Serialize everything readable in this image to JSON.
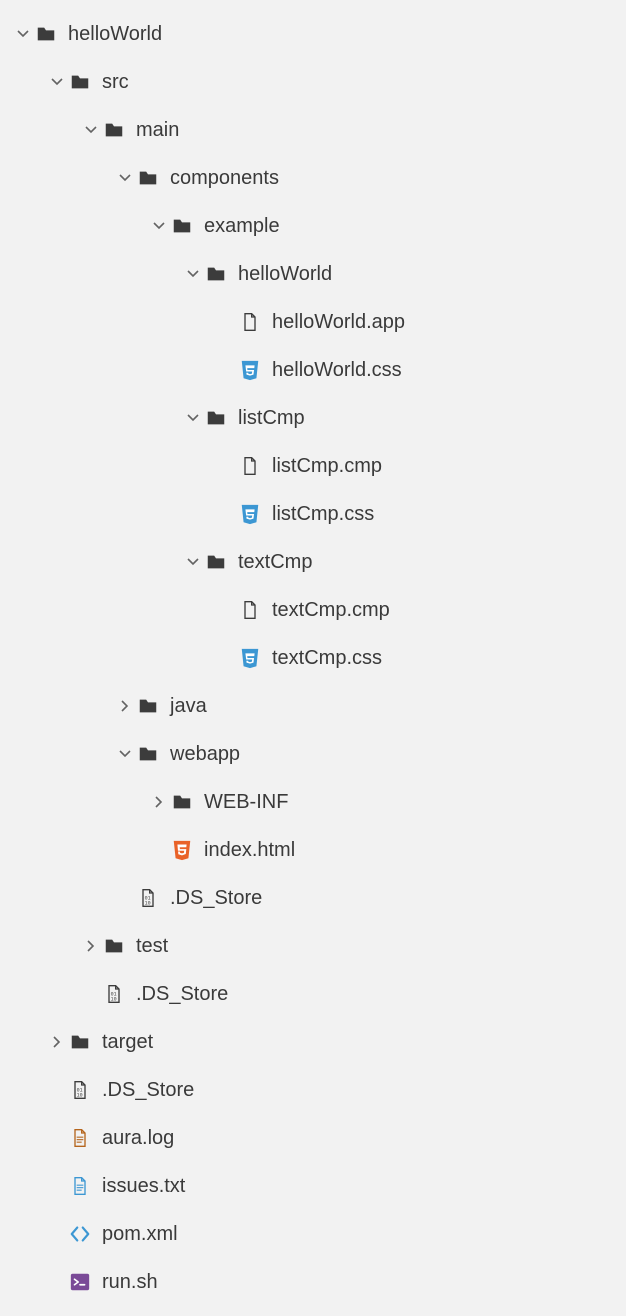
{
  "rows": [
    {
      "label": "helloWorld",
      "depth": 0,
      "expanded": true,
      "type": "folder"
    },
    {
      "label": "src",
      "depth": 1,
      "expanded": true,
      "type": "folder"
    },
    {
      "label": "main",
      "depth": 2,
      "expanded": true,
      "type": "folder"
    },
    {
      "label": "components",
      "depth": 3,
      "expanded": true,
      "type": "folder"
    },
    {
      "label": "example",
      "depth": 4,
      "expanded": true,
      "type": "folder"
    },
    {
      "label": "helloWorld",
      "depth": 5,
      "expanded": true,
      "type": "folder"
    },
    {
      "label": "helloWorld.app",
      "depth": 6,
      "expanded": null,
      "type": "file"
    },
    {
      "label": "helloWorld.css",
      "depth": 6,
      "expanded": null,
      "type": "css"
    },
    {
      "label": "listCmp",
      "depth": 5,
      "expanded": true,
      "type": "folder"
    },
    {
      "label": "listCmp.cmp",
      "depth": 6,
      "expanded": null,
      "type": "file"
    },
    {
      "label": "listCmp.css",
      "depth": 6,
      "expanded": null,
      "type": "css"
    },
    {
      "label": "textCmp",
      "depth": 5,
      "expanded": true,
      "type": "folder"
    },
    {
      "label": "textCmp.cmp",
      "depth": 6,
      "expanded": null,
      "type": "file"
    },
    {
      "label": "textCmp.css",
      "depth": 6,
      "expanded": null,
      "type": "css"
    },
    {
      "label": "java",
      "depth": 3,
      "expanded": false,
      "type": "folder"
    },
    {
      "label": "webapp",
      "depth": 3,
      "expanded": true,
      "type": "folder"
    },
    {
      "label": "WEB-INF",
      "depth": 4,
      "expanded": false,
      "type": "folder"
    },
    {
      "label": "index.html",
      "depth": 4,
      "expanded": null,
      "type": "html"
    },
    {
      "label": ".DS_Store",
      "depth": 3,
      "expanded": null,
      "type": "binary"
    },
    {
      "label": "test",
      "depth": 2,
      "expanded": false,
      "type": "folder"
    },
    {
      "label": ".DS_Store",
      "depth": 2,
      "expanded": null,
      "type": "binary"
    },
    {
      "label": "target",
      "depth": 1,
      "expanded": false,
      "type": "folder"
    },
    {
      "label": ".DS_Store",
      "depth": 1,
      "expanded": null,
      "type": "binary"
    },
    {
      "label": "aura.log",
      "depth": 1,
      "expanded": null,
      "type": "log"
    },
    {
      "label": "issues.txt",
      "depth": 1,
      "expanded": null,
      "type": "txt"
    },
    {
      "label": "pom.xml",
      "depth": 1,
      "expanded": null,
      "type": "xml"
    },
    {
      "label": "run.sh",
      "depth": 1,
      "expanded": null,
      "type": "sh"
    }
  ]
}
